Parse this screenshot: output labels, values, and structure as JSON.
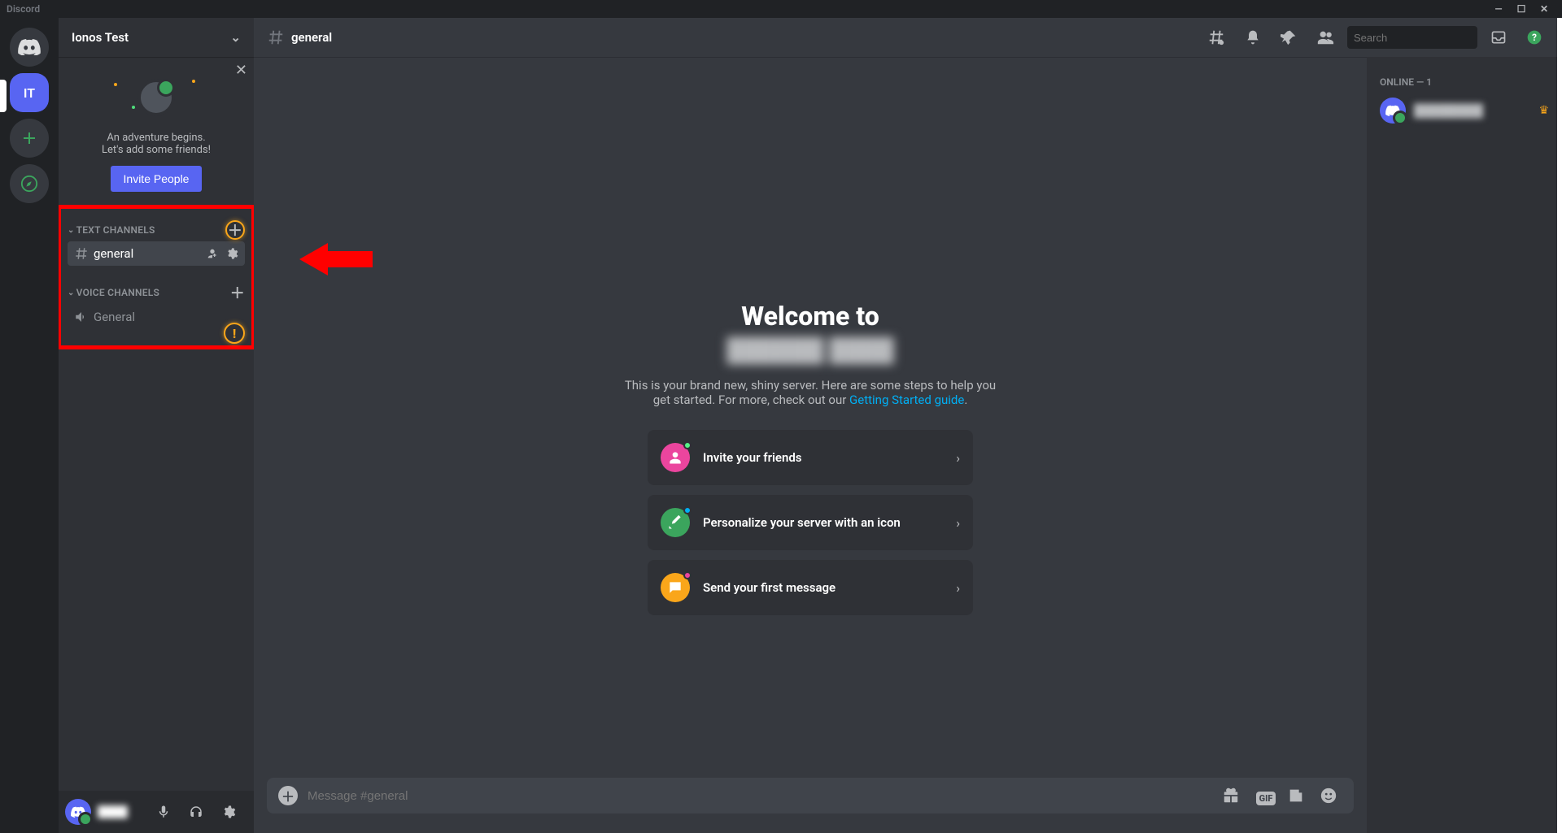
{
  "app_name": "Discord",
  "server": {
    "name": "Ionos Test",
    "initials": "IT"
  },
  "invite_card": {
    "line1": "An adventure begins.",
    "line2": "Let's add some friends!",
    "button": "Invite People"
  },
  "channels": {
    "text_header": "Text Channels",
    "voice_header": "Voice Channels",
    "text": [
      {
        "name": "general",
        "active": true
      }
    ],
    "voice": [
      {
        "name": "General"
      }
    ]
  },
  "chat_header": {
    "channel": "general",
    "search_placeholder": "Search"
  },
  "welcome": {
    "title": "Welcome to",
    "server_name_blurred": "██████ ████",
    "desc_prefix": "This is your brand new, shiny server. Here are some steps to help you get started. For more, check out our ",
    "guide_link": "Getting Started guide",
    "desc_suffix": ".",
    "cards": [
      "Invite your friends",
      "Personalize your server with an icon",
      "Send your first message"
    ]
  },
  "compose": {
    "placeholder": "Message #general"
  },
  "members": {
    "header": "Online — 1",
    "list": [
      {
        "name_blurred": "████████"
      }
    ]
  },
  "user_panel": {
    "name_blurred": "████"
  }
}
